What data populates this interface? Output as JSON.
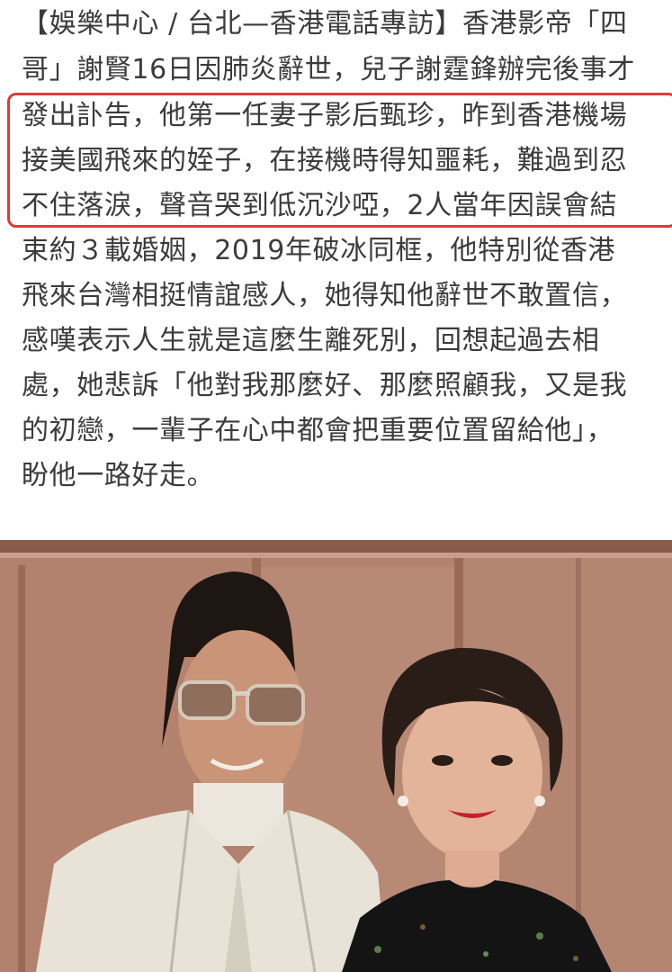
{
  "article": {
    "lines": [
      "【娛樂中心 / 台北—香港電話專訪】香港影帝「四",
      "哥」謝賢16日因肺炎辭世，兒子謝霆鋒辦完後事才",
      "發出訃告，他第一任妻子影后甄珍，昨到香港機場",
      "接美國飛來的姪子，在接機時得知噩耗，難過到忍",
      "不住落淚，聲音哭到低沉沙啞，2人當年因誤會結",
      "束約３載婚姻，2019年破冰同框，他特別從香港",
      "飛來台灣相挺情誼感人，她得知他辭世不敢置信，",
      "感嘆表示人生就是這麼生離死別，回想起過去相",
      "處，她悲訴「他對我那麼好、那麼照顧我，又是我",
      "的初戀，一輩子在心中都會把重要位置留給他」，",
      "盼他一路好走。"
    ],
    "highlight_color": "#e03a3a"
  },
  "photo": {
    "subject": "two-person-portrait"
  }
}
